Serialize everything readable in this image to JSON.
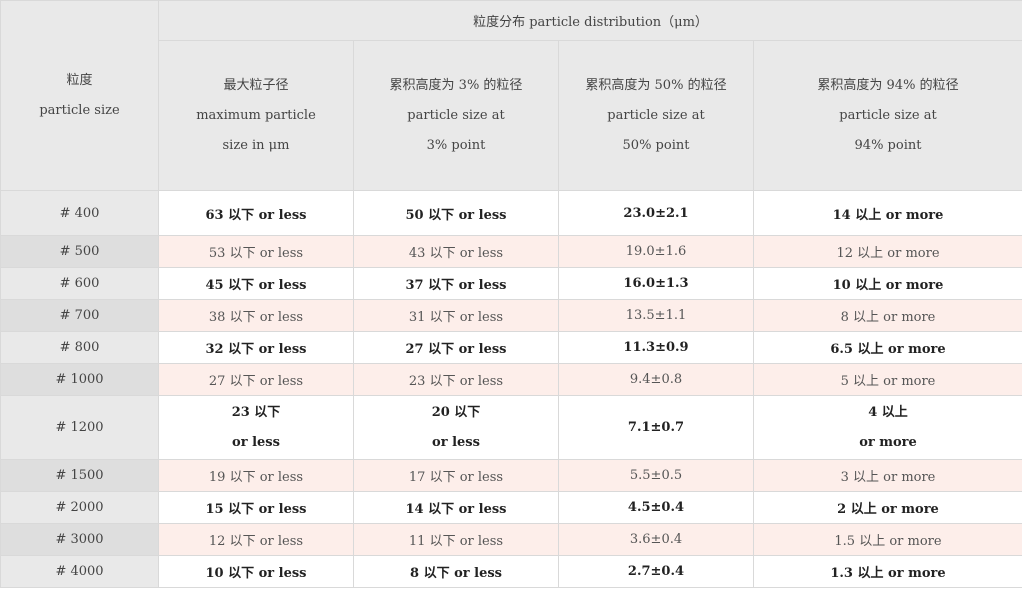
{
  "header": {
    "col0_line1": "粒度",
    "col0_line2": "particle size",
    "group": "粒度分布 particle distribution（μm）",
    "cols": [
      {
        "line1": "最大粒子径",
        "line2": "maximum particle",
        "line3": "size in  μm"
      },
      {
        "line1": "累积高度为  3%  的粒径",
        "line2": "particle size at",
        "line3": "3% point"
      },
      {
        "line1": "累积高度为  50%  的粒径",
        "line2": "particle size at",
        "line3": "50% point"
      },
      {
        "line1": "累积高度为  94%  的粒径",
        "line2": "particle size at",
        "line3": "94% point"
      }
    ]
  },
  "rows": [
    {
      "size": "# 400",
      "max": "63 以下 or less",
      "p3": "50 以下 or less",
      "p50": "23.0±2.1",
      "p94": "14 以上 or more"
    },
    {
      "size": "# 500",
      "max": "53 以下 or less",
      "p3": "43 以下 or less",
      "p50": "19.0±1.6",
      "p94": "12 以上 or more"
    },
    {
      "size": "# 600",
      "max": "45 以下 or less",
      "p3": "37 以下 or less",
      "p50": "16.0±1.3",
      "p94": "10 以上 or more"
    },
    {
      "size": "# 700",
      "max": "38 以下 or less",
      "p3": "31 以下 or less",
      "p50": "13.5±1.1",
      "p94": "8 以上 or more"
    },
    {
      "size": "# 800",
      "max": "32 以下 or less",
      "p3": "27 以下 or less",
      "p50": "11.3±0.9",
      "p94": "6.5 以上 or more"
    },
    {
      "size": "# 1000",
      "max": "27 以下 or less",
      "p3": "23 以下 or less",
      "p50": "9.4±0.8",
      "p94": "5 以上 or more"
    },
    {
      "size": "# 1200",
      "max_a": "23 以下",
      "max_b": "or less",
      "p3_a": "20 以下",
      "p3_b": "or less",
      "p50": "7.1±0.7",
      "p94_a": "4 以上",
      "p94_b": "or more"
    },
    {
      "size": "# 1500",
      "max": "19 以下 or less",
      "p3": "17 以下 or less",
      "p50": "5.5±0.5",
      "p94": "3 以上 or more"
    },
    {
      "size": "# 2000",
      "max": "15 以下 or less",
      "p3": "14 以下 or less",
      "p50": "4.5±0.4",
      "p94": "2 以上 or more"
    },
    {
      "size": "# 3000",
      "max": "12 以下 or less",
      "p3": "11 以下 or less",
      "p50": "3.6±0.4",
      "p94": "1.5 以上 or more"
    },
    {
      "size": "# 4000",
      "max": "10 以下 or less",
      "p3": "8 以下 or less",
      "p50": "2.7±0.4",
      "p94": "1.3 以上 or more"
    }
  ]
}
